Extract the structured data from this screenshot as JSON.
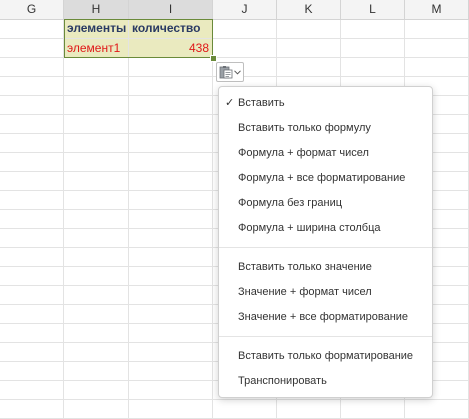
{
  "columns": [
    "G",
    "H",
    "I",
    "J",
    "K",
    "L",
    "M"
  ],
  "cells": {
    "h1": "элементы",
    "i1": "количество",
    "h2": "элемент1",
    "i2": "438"
  },
  "paste_button": {
    "icon": "clipboard-icon",
    "dropdown_icon": "chevron-down-icon"
  },
  "menu": {
    "group1": [
      "Вставить",
      "Вставить только формулу",
      "Формула + формат чисел",
      "Формула + все форматирование",
      "Формула без границ",
      "Формула + ширина столбца"
    ],
    "group2": [
      "Вставить только значение",
      "Значение + формат чисел",
      "Значение + все форматирование"
    ],
    "group3": [
      "Вставить только форматирование",
      "Транспонировать"
    ],
    "checked_mark": "✓"
  },
  "colors": {
    "header_fill": "#eaeabf",
    "header_text": "#2a3a63",
    "data_text": "#e01818",
    "selection_border": "#6a8a3a"
  }
}
